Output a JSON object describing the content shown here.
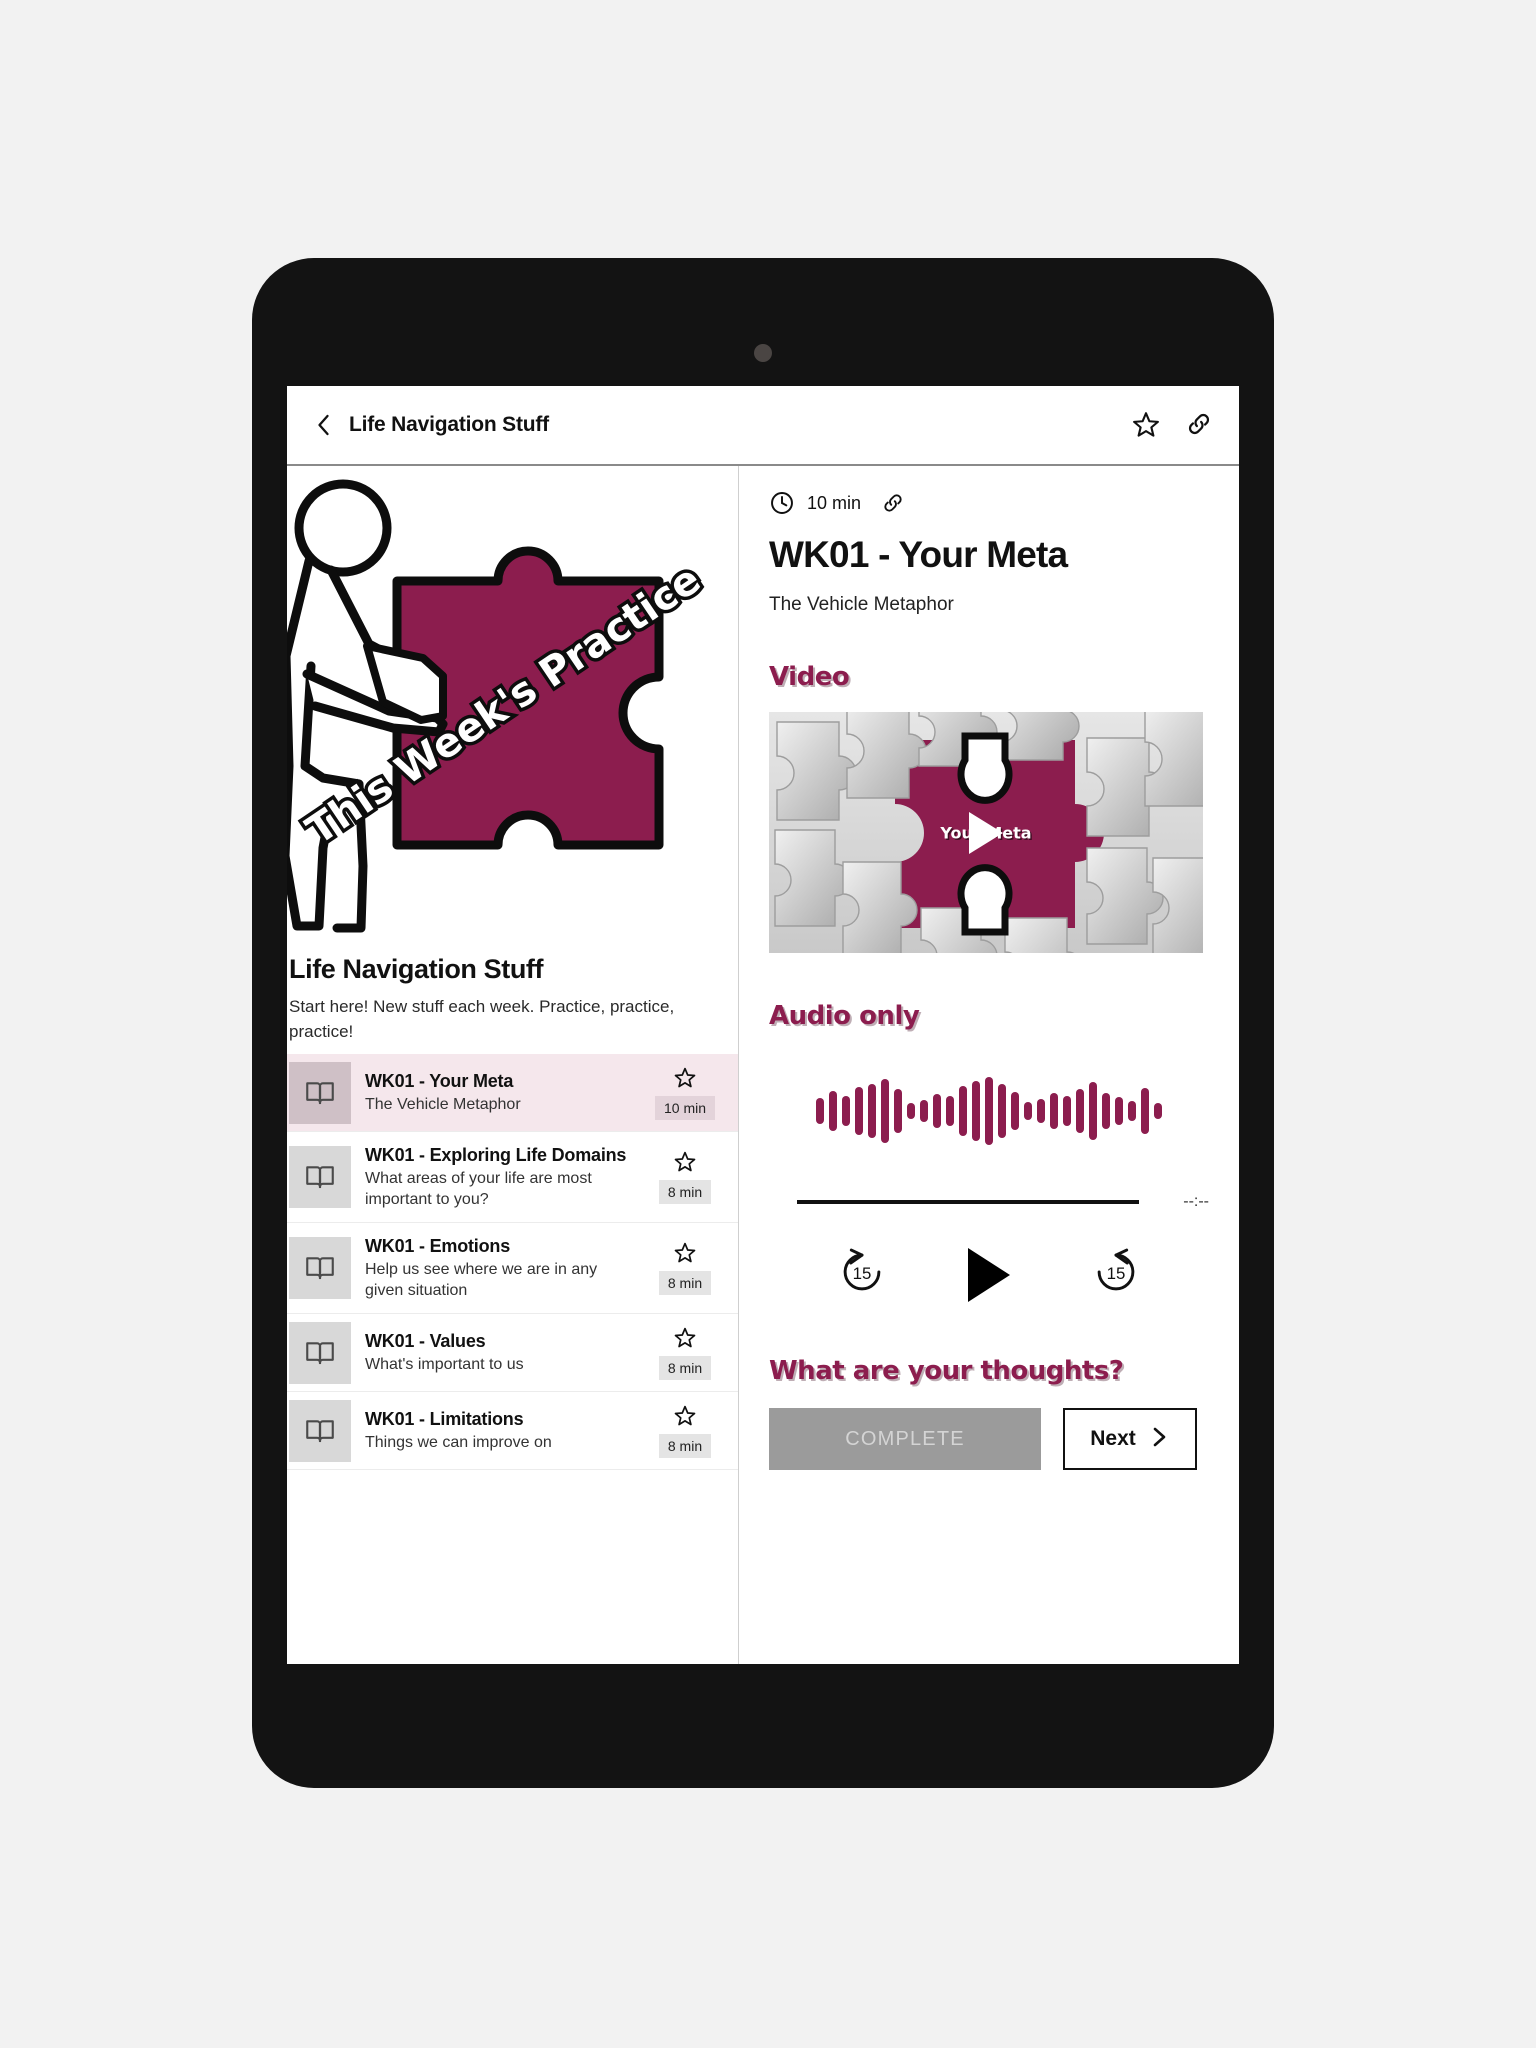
{
  "appbar": {
    "back_icon": "chevron-left-icon",
    "title": "Life Navigation Stuff",
    "star_icon": "star-outline-icon",
    "link_icon": "link-icon"
  },
  "left_pane": {
    "hero": {
      "badge_text": "This Week's Practice",
      "image_name": "stick-figure-pushing-puzzle-piece"
    },
    "course_title": "Life Navigation Stuff",
    "course_description": "Start here! New stuff each week.  Practice, practice, practice!",
    "lessons": [
      {
        "title": "WK01 - Your Meta",
        "subtitle": "The Vehicle Metaphor",
        "duration": "10 min",
        "selected": true,
        "icon": "book-icon",
        "star_icon": "star-outline-icon"
      },
      {
        "title": "WK01 - Exploring Life Domains",
        "subtitle": "What areas of your life are most important to you?",
        "duration": "8 min",
        "selected": false,
        "icon": "book-icon",
        "star_icon": "star-outline-icon"
      },
      {
        "title": "WK01 - Emotions",
        "subtitle": "Help us see where we are in any given situation",
        "duration": "8 min",
        "selected": false,
        "icon": "book-icon",
        "star_icon": "star-outline-icon"
      },
      {
        "title": "WK01 - Values",
        "subtitle": "What's important to us",
        "duration": "8 min",
        "selected": false,
        "icon": "book-icon",
        "star_icon": "star-outline-icon"
      },
      {
        "title": "WK01 - Limitations",
        "subtitle": "Things we can improve on",
        "duration": "8 min",
        "selected": false,
        "icon": "book-icon",
        "star_icon": "star-outline-icon"
      }
    ]
  },
  "right_pane": {
    "duration": "10 min",
    "clock_icon": "clock-icon",
    "link_icon": "link-icon",
    "title": "WK01 - Your Meta",
    "subtitle": "The Vehicle Metaphor",
    "video_heading": "Video",
    "video": {
      "caption": "Your Meta",
      "play_icon": "play-icon",
      "thumbnail_name": "puzzle-pieces-maroon-gap"
    },
    "audio_heading": "Audio only",
    "audio": {
      "waveform_name": "audio-waveform",
      "time_display": "--:--",
      "rewind_label": "15",
      "forward_label": "15",
      "rewind_icon": "rewind-15-icon",
      "play_icon": "play-icon",
      "forward_icon": "forward-15-icon"
    },
    "thoughts_heading": "What are your thoughts?",
    "complete_label": "COMPLETE",
    "next_label": "Next",
    "next_icon": "chevron-right-icon"
  },
  "colors": {
    "accent_maroon": "#8c1d4e",
    "selected_row_bg": "#f5e7ec",
    "disabled_button_bg": "#9b9b9b",
    "device_bezel": "#131313",
    "page_bg": "#f2f2f2"
  },
  "waveform_heights": [
    26,
    40,
    30,
    48,
    54,
    64,
    44,
    16,
    22,
    34,
    30,
    50,
    60,
    68,
    54,
    38,
    18,
    24,
    36,
    30,
    44,
    58,
    36,
    28,
    20,
    46,
    16
  ]
}
